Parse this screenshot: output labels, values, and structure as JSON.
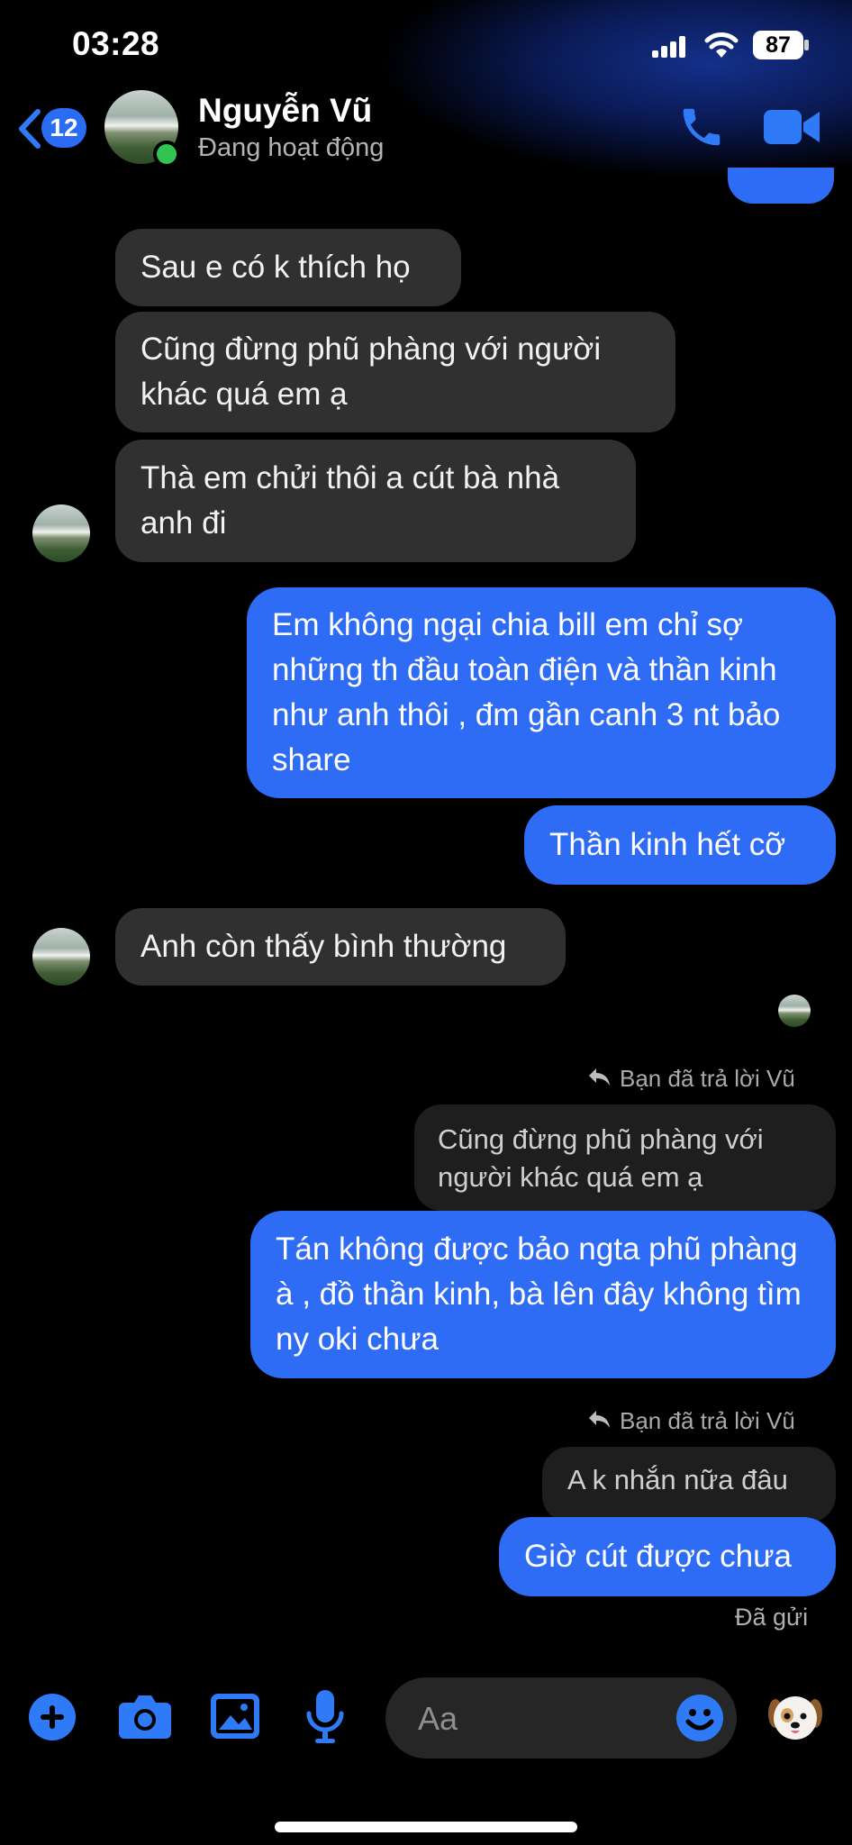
{
  "status_bar": {
    "time": "03:28",
    "battery": "87"
  },
  "header": {
    "back_count": "12",
    "contact_name": "Nguyễn Vũ",
    "contact_status": "Đang hoạt động"
  },
  "messages": [
    {
      "side": "in",
      "text": "Sau e có k thích họ"
    },
    {
      "side": "in",
      "text": "Cũng đừng phũ phàng với người khác quá em ạ"
    },
    {
      "side": "in",
      "text": "Thà em chửi thôi a cút bà nhà anh đi"
    },
    {
      "side": "out",
      "text": "Em không ngại chia bill em chỉ sợ những th đầu toàn điện và thần kinh như anh thôi , đm gần canh 3 nt bảo share"
    },
    {
      "side": "out",
      "text": "Thần kinh hết cỡ"
    },
    {
      "side": "in",
      "text": "Anh còn thấy bình thường"
    },
    {
      "side": "out",
      "reply_label": "Bạn đã trả lời Vũ",
      "quoted": "Cũng đừng phũ phàng với người khác quá em ạ",
      "text": "Tán không được bảo ngta phũ phàng à , đồ thần kinh, bà lên đây không tìm ny oki chưa"
    },
    {
      "side": "out",
      "reply_label": "Bạn đã trả lời Vũ",
      "quoted": "A k nhắn nữa đâu",
      "text": "Giờ cút được chưa"
    }
  ],
  "sent_status": "Đã gửi",
  "composer": {
    "placeholder": "Aa"
  },
  "colors": {
    "accent": "#2f6cf6",
    "incoming_bubble": "#303030",
    "online": "#31c452"
  },
  "icons": [
    "back-chevron-icon",
    "phone-icon",
    "video-camera-icon",
    "plus-icon",
    "camera-icon",
    "image-icon",
    "microphone-icon",
    "emoji-icon",
    "dog-sticker-icon"
  ]
}
